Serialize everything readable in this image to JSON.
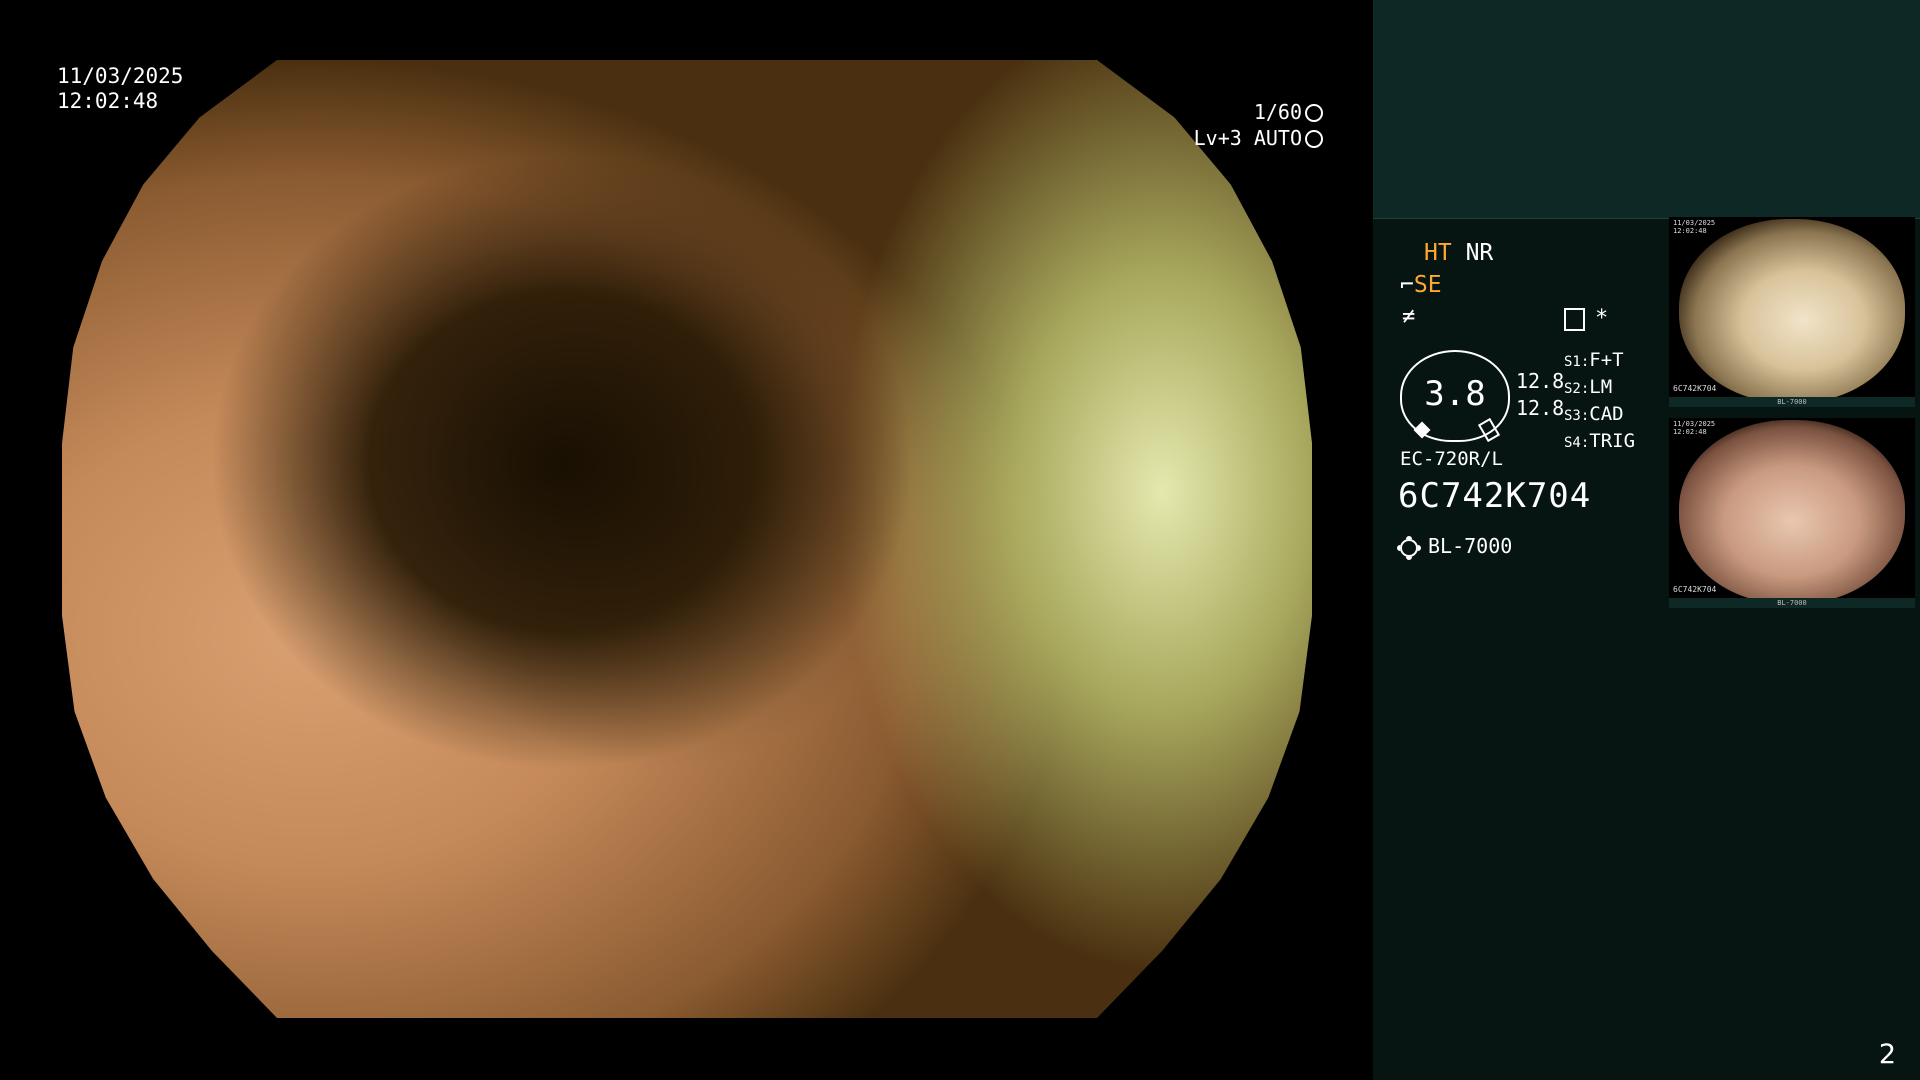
{
  "overlay": {
    "date": "11/03/2025",
    "time": "12:02:48",
    "shutter": "1/60",
    "level": "Lv+3",
    "mode": "AUTO"
  },
  "panel": {
    "ht": "HT",
    "nr": "NR",
    "se": "SE",
    "gauge_value": "3.8",
    "gauge_side_a": "12.8",
    "gauge_side_b": "12.8",
    "s_items": [
      {
        "key": "S1:",
        "value": "F+T"
      },
      {
        "key": "S2:",
        "value": "LM"
      },
      {
        "key": "S3:",
        "value": "CAD"
      },
      {
        "key": "S4:",
        "value": "TRIG"
      }
    ],
    "model": "EC-720R/L",
    "serial": "6C742K704",
    "light_source": "BL-7000",
    "page_number": "2"
  },
  "thumbnails": [
    {
      "date": "11/03/2025",
      "time": "12:02:48",
      "id": "6C742K704",
      "footer": "BL-7000"
    },
    {
      "date": "11/03/2025",
      "time": "12:02:48",
      "id": "6C742K704",
      "footer": "BL-7000"
    }
  ],
  "colors": {
    "panel_bg": "#061412",
    "panel_top_bg": "#0e2826",
    "accent_orange": "#ffa830"
  }
}
